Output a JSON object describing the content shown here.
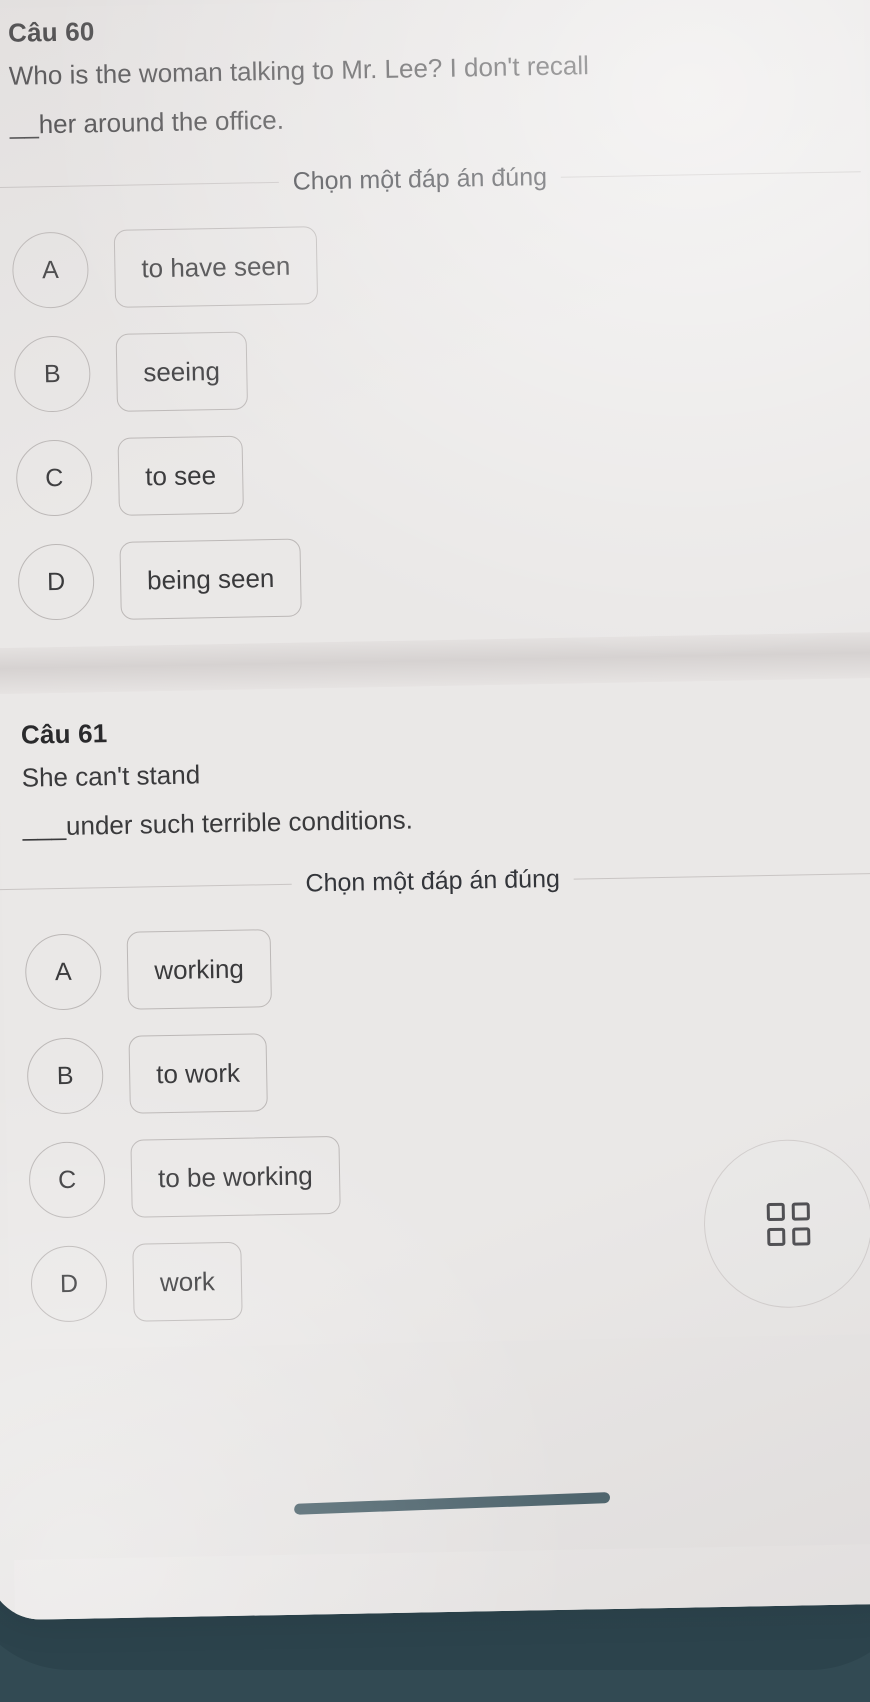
{
  "questions": [
    {
      "number_label": "Câu 60",
      "stem_line1": "Who is the woman talking to Mr. Lee? I don't recall",
      "stem_line2": "__her around the office.",
      "prompt": "Chọn một đáp án đúng",
      "options": [
        {
          "key": "A",
          "text": "to have seen"
        },
        {
          "key": "B",
          "text": "seeing"
        },
        {
          "key": "C",
          "text": "to see"
        },
        {
          "key": "D",
          "text": "being seen"
        }
      ]
    },
    {
      "number_label": "Câu 61",
      "stem_line1": "She can't stand",
      "stem_line2": "___under such terrible conditions.",
      "prompt": "Chọn một đáp án đúng",
      "options": [
        {
          "key": "A",
          "text": "working"
        },
        {
          "key": "B",
          "text": "to work"
        },
        {
          "key": "C",
          "text": "to be working"
        },
        {
          "key": "D",
          "text": "work"
        }
      ]
    }
  ],
  "floating_button": {
    "icon": "grid-apps-icon"
  },
  "colors": {
    "screen_background": "#eae8e7",
    "card_background": "#eae8e7",
    "separator_band": "#d6d2d1",
    "text_primary": "#2a2a2c",
    "text_secondary": "#3a3a3c",
    "outline": "#bcb8b7",
    "bezel": "#2d4750",
    "home_indicator": "#3c5660"
  }
}
